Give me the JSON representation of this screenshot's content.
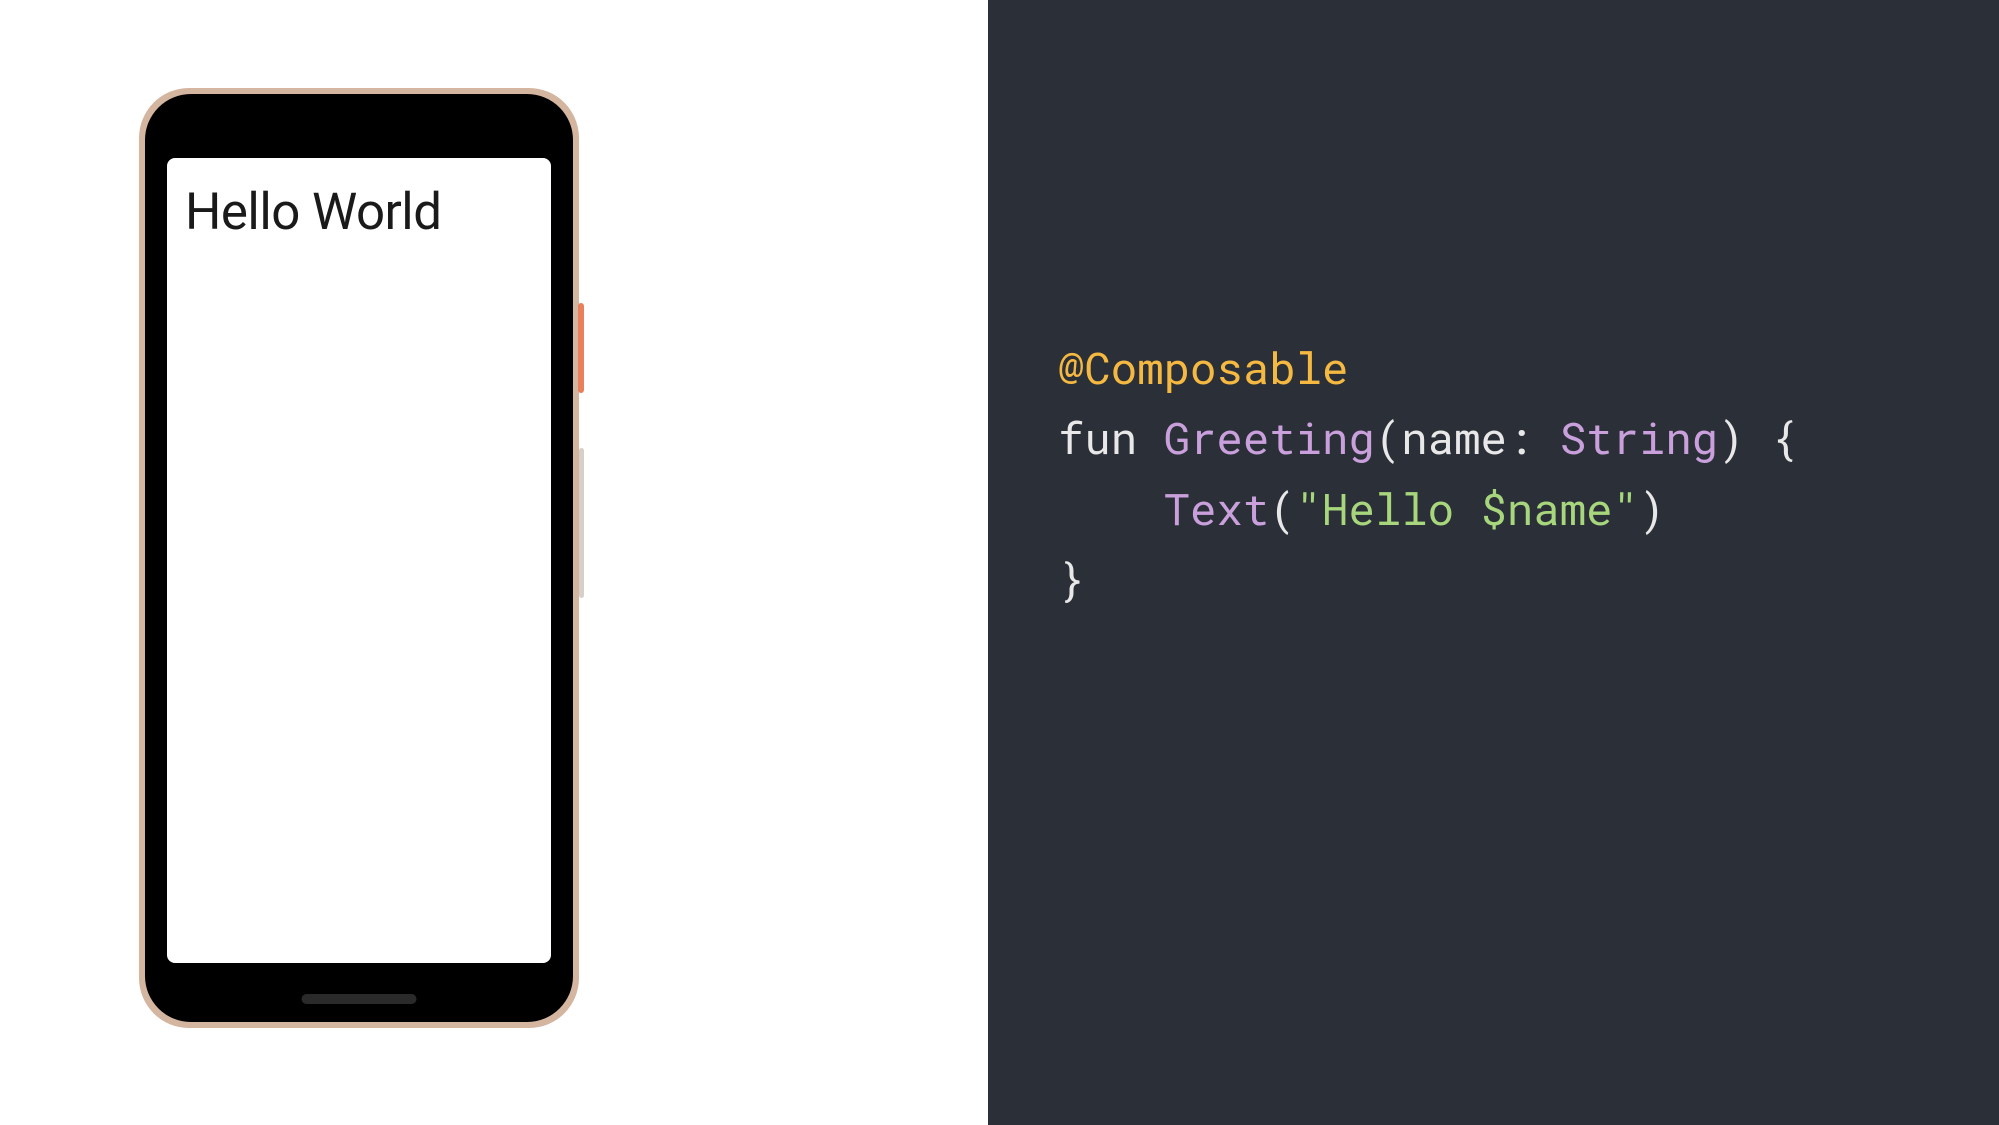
{
  "preview": {
    "screen_text": "Hello World"
  },
  "code": {
    "line1": {
      "annotation": "@Composable"
    },
    "line2": {
      "keyword": "fun",
      "function_name": "Greeting",
      "paren_open": "(",
      "param_name": "name",
      "colon": ":",
      "param_type": "String",
      "paren_close": ")",
      "brace_open": "{"
    },
    "line3": {
      "indent": "    ",
      "function_call": "Text",
      "paren_open": "(",
      "string_literal": "\"Hello $name\"",
      "paren_close": ")"
    },
    "line4": {
      "brace_close": "}"
    }
  },
  "colors": {
    "code_bg": "#2b2f38",
    "annotation": "#f5b942",
    "function": "#c9a0dc",
    "string": "#a8d67c",
    "default": "#e8e8e8"
  }
}
